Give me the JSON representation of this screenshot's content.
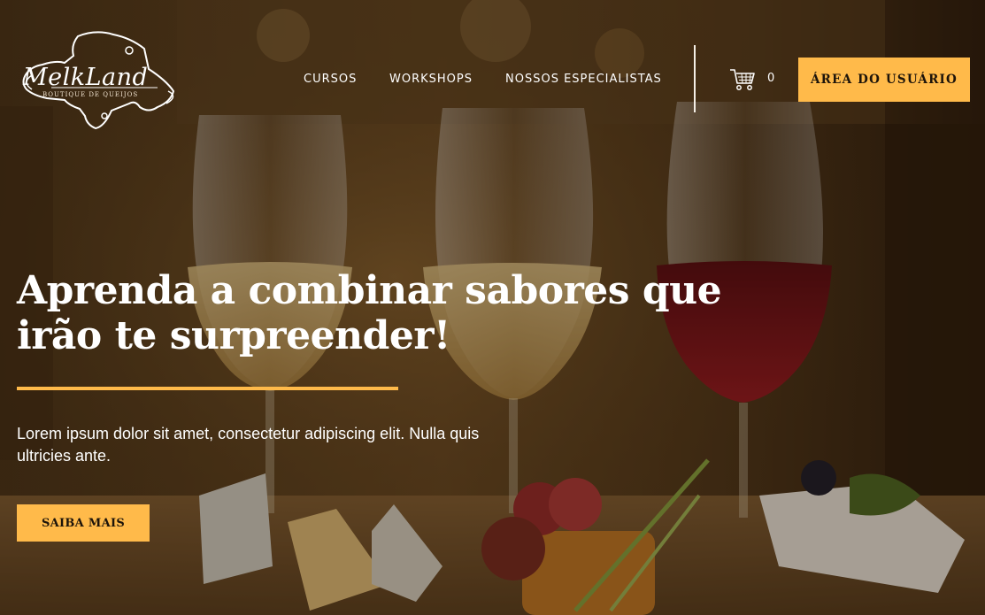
{
  "logo": {
    "brand": "MelkLand",
    "tagline": "Boutique de Queijos"
  },
  "nav": {
    "items": [
      {
        "label": "CURSOS"
      },
      {
        "label": "WORKSHOPS"
      },
      {
        "label": "NOSSOS ESPECIALISTAS"
      }
    ]
  },
  "cart": {
    "icon": "shopping-cart-icon",
    "count": "0"
  },
  "header": {
    "user_area_label": "ÁREA DO USUÁRIO"
  },
  "hero": {
    "title": "Aprenda a combinar sabores que irão te surpreender!",
    "description": "Lorem ipsum dolor sit amet, consectetur adipiscing elit. Nulla quis ultricies ante.",
    "cta_label": "SAIBA MAIS"
  },
  "colors": {
    "accent": "#ffba4a",
    "text": "#ffffff",
    "button_text": "#1d140a"
  }
}
